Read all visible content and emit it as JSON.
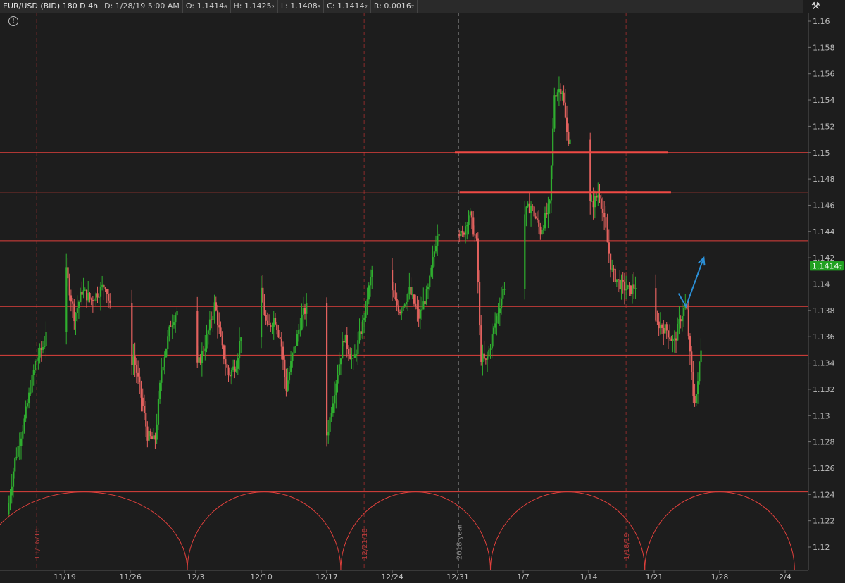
{
  "header": {
    "symbol": "EUR/USD (BID) 180 D 4h",
    "date": "D: 1/28/19 5:00 AM",
    "open": "O: 1.1414₆",
    "high": "H: 1.1425₂",
    "low": "L: 1.1408₅",
    "close": "C: 1.1414₇",
    "range": "R: 0.0016₇"
  },
  "icons": {
    "info": "info-circle-icon",
    "settings": "wrench-cursor-icon"
  },
  "colors": {
    "background": "#1d1d1d",
    "up": "#2fae2f",
    "down": "#e2615e",
    "hline": "#e0403c",
    "annotation": "#2b8fd6",
    "price_tag": "#20a020"
  },
  "chart_data": {
    "type": "candlestick",
    "title": "EUR/USD (BID) 180 D 4h",
    "ylim": [
      1.1175,
      1.1615
    ],
    "y_ticks": [
      "1.12",
      "1.122",
      "1.124",
      "1.126",
      "1.128",
      "1.13",
      "1.132",
      "1.134",
      "1.136",
      "1.138",
      "1.14",
      "1.142",
      "1.144",
      "1.146",
      "1.148",
      "1.15",
      "1.152",
      "1.154",
      "1.156",
      "1.158",
      "1.16"
    ],
    "x_ticks": [
      "11/19",
      "11/26",
      "12/3",
      "12/10",
      "12/17",
      "12/24",
      "12/31",
      "1/7",
      "1/14",
      "1/21",
      "1/28",
      "2/4"
    ],
    "x_tick_days": [
      3,
      10,
      17,
      24,
      31,
      38,
      45,
      52,
      59,
      66,
      73,
      80
    ],
    "data_start_day": -3,
    "data_end_day": 71.3,
    "path_points": [
      [
        -3,
        1.1225
      ],
      [
        -2.2,
        1.1265
      ],
      [
        -1.2,
        1.1295
      ],
      [
        0,
        1.134
      ],
      [
        1,
        1.1355
      ],
      [
        1.8,
        1.1405
      ],
      [
        2.3,
        1.146
      ],
      [
        2.8,
        1.144
      ],
      [
        3.3,
        1.141
      ],
      [
        4.2,
        1.1375
      ],
      [
        5,
        1.1395
      ],
      [
        6,
        1.1388
      ],
      [
        7.5,
        1.14
      ],
      [
        8.2,
        1.1375
      ],
      [
        8.8,
        1.134
      ],
      [
        9.5,
        1.1325
      ],
      [
        10.5,
        1.1345
      ],
      [
        11.2,
        1.132
      ],
      [
        12,
        1.1285
      ],
      [
        12.8,
        1.128
      ],
      [
        13.5,
        1.1335
      ],
      [
        14.5,
        1.137
      ],
      [
        15.5,
        1.1385
      ],
      [
        16.3,
        1.136
      ],
      [
        17,
        1.133
      ],
      [
        18.2,
        1.1355
      ],
      [
        19.2,
        1.1385
      ],
      [
        20,
        1.135
      ],
      [
        20.7,
        1.133
      ],
      [
        21.5,
        1.134
      ],
      [
        22.5,
        1.1385
      ],
      [
        23.3,
        1.1435
      ],
      [
        24,
        1.14
      ],
      [
        24.8,
        1.1365
      ],
      [
        25.6,
        1.1375
      ],
      [
        26.3,
        1.1355
      ],
      [
        26.8,
        1.132
      ],
      [
        27.5,
        1.1345
      ],
      [
        28.5,
        1.1375
      ],
      [
        29.2,
        1.1385
      ],
      [
        30,
        1.135
      ],
      [
        30.5,
        1.13
      ],
      [
        31.2,
        1.1285
      ],
      [
        32,
        1.132
      ],
      [
        33,
        1.136
      ],
      [
        34,
        1.134
      ],
      [
        35,
        1.137
      ],
      [
        36,
        1.141
      ],
      [
        36.8,
        1.147
      ],
      [
        37.5,
        1.1455
      ],
      [
        38.2,
        1.139
      ],
      [
        39,
        1.138
      ],
      [
        40,
        1.1395
      ],
      [
        41,
        1.1375
      ],
      [
        42,
        1.1395
      ],
      [
        43,
        1.144
      ],
      [
        44,
        1.1455
      ],
      [
        44.8,
        1.145
      ],
      [
        45.6,
        1.1435
      ],
      [
        46.4,
        1.1455
      ],
      [
        47.2,
        1.143
      ],
      [
        47.6,
        1.1345
      ],
      [
        48.2,
        1.134
      ],
      [
        49,
        1.1365
      ],
      [
        50,
        1.1395
      ],
      [
        51,
        1.142
      ],
      [
        52,
        1.145
      ],
      [
        53,
        1.146
      ],
      [
        54,
        1.144
      ],
      [
        55,
        1.146
      ],
      [
        55.5,
        1.1545
      ],
      [
        56.3,
        1.155
      ],
      [
        56.9,
        1.151
      ],
      [
        57.6,
        1.1515
      ],
      [
        58.2,
        1.149
      ],
      [
        58.7,
        1.1465
      ],
      [
        59.5,
        1.146
      ],
      [
        60.3,
        1.147
      ],
      [
        61,
        1.144
      ],
      [
        61.6,
        1.141
      ],
      [
        62.5,
        1.14
      ],
      [
        63.5,
        1.1395
      ],
      [
        64.3,
        1.14
      ],
      [
        65,
        1.138
      ],
      [
        65.8,
        1.1365
      ],
      [
        66.6,
        1.137
      ],
      [
        67.5,
        1.1365
      ],
      [
        68.3,
        1.1355
      ],
      [
        69,
        1.1375
      ],
      [
        69.6,
        1.1385
      ],
      [
        70,
        1.1345
      ],
      [
        70.4,
        1.131
      ],
      [
        70.8,
        1.132
      ],
      [
        71,
        1.134
      ],
      [
        71.2,
        1.1355
      ],
      [
        71.4,
        1.14
      ],
      [
        71.6,
        1.141
      ],
      [
        71.9,
        1.1415
      ]
    ],
    "candle_range": 0.0018,
    "horizontal_levels": [
      1.15,
      1.147,
      1.1433,
      1.1383,
      1.1346,
      1.1242
    ],
    "resistance_segments": [
      {
        "y": 1.15,
        "from_day": 44.7,
        "to_day": 67.5
      },
      {
        "y": 1.147,
        "from_day": 45.2,
        "to_day": 67.8
      }
    ],
    "last_price": "1.1414₇",
    "last_price_value": 1.1414,
    "vertical_markers": [
      {
        "label": "11/16/18",
        "day": 0,
        "style": "red"
      },
      {
        "label": "12/21/18",
        "day": 35,
        "style": "red"
      },
      {
        "label": "2018 year",
        "day": 45.1,
        "style": "grey"
      },
      {
        "label": "1/18/19",
        "day": 63,
        "style": "red"
      }
    ],
    "cycle_arcs_days": [
      [
        -6,
        16.1
      ],
      [
        16.1,
        32.5
      ],
      [
        32.5,
        48.5
      ],
      [
        48.5,
        65
      ],
      [
        65,
        81
      ]
    ],
    "cycle_arc_top": 1.1242,
    "annotation_arrow": [
      [
        68.6,
        1.1393
      ],
      [
        69.4,
        1.1383
      ],
      [
        71.3,
        1.142
      ]
    ]
  }
}
